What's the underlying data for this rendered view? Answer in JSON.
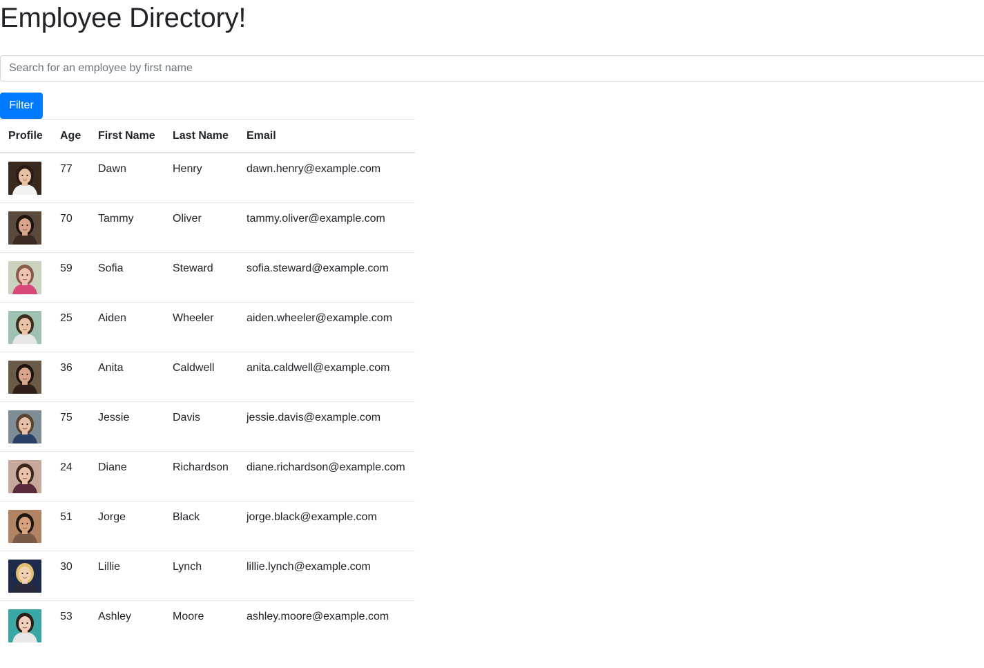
{
  "page": {
    "title": "Employee Directory!"
  },
  "search": {
    "placeholder": "Search for an employee by first name",
    "value": ""
  },
  "filter_button": {
    "label": "Filter",
    "color": "#007bff"
  },
  "table": {
    "headers": {
      "profile": "Profile",
      "age": "Age",
      "first_name": "First Name",
      "last_name": "Last Name",
      "email": "Email"
    },
    "rows": [
      {
        "age": "77",
        "first_name": "Dawn",
        "last_name": "Henry",
        "email": "dawn.henry@example.com",
        "avatar": {
          "bg": "#3a2a1e",
          "skin": "#e8c2a4",
          "hair": "#2b1a12",
          "shirt": "#f2f2f2"
        }
      },
      {
        "age": "70",
        "first_name": "Tammy",
        "last_name": "Oliver",
        "email": "tammy.oliver@example.com",
        "avatar": {
          "bg": "#5a4a3c",
          "skin": "#d8a58a",
          "hair": "#1e120c",
          "shirt": "#3a2a22"
        }
      },
      {
        "age": "59",
        "first_name": "Sofia",
        "last_name": "Steward",
        "email": "sofia.steward@example.com",
        "avatar": {
          "bg": "#c9d3c0",
          "skin": "#f0c4b4",
          "hair": "#8a5a4a",
          "shirt": "#d8467a"
        }
      },
      {
        "age": "25",
        "first_name": "Aiden",
        "last_name": "Wheeler",
        "email": "aiden.wheeler@example.com",
        "avatar": {
          "bg": "#9fc2b0",
          "skin": "#e8c4a8",
          "hair": "#3a2a1e",
          "shirt": "#e6e6e6"
        }
      },
      {
        "age": "36",
        "first_name": "Anita",
        "last_name": "Caldwell",
        "email": "anita.caldwell@example.com",
        "avatar": {
          "bg": "#6a5a48",
          "skin": "#d8a58a",
          "hair": "#1e120c",
          "shirt": "#2e2018"
        }
      },
      {
        "age": "75",
        "first_name": "Jessie",
        "last_name": "Davis",
        "email": "jessie.davis@example.com",
        "avatar": {
          "bg": "#7e8c96",
          "skin": "#e6c2aa",
          "hair": "#5a4230",
          "shirt": "#2a3e66"
        }
      },
      {
        "age": "24",
        "first_name": "Diane",
        "last_name": "Richardson",
        "email": "diane.richardson@example.com",
        "avatar": {
          "bg": "#c6a89a",
          "skin": "#ecc4ae",
          "hair": "#3a2418",
          "shirt": "#5a2a3a"
        }
      },
      {
        "age": "51",
        "first_name": "Jorge",
        "last_name": "Black",
        "email": "jorge.black@example.com",
        "avatar": {
          "bg": "#b08462",
          "skin": "#d9a27e",
          "hair": "#1e140e",
          "shirt": "#7a5a44"
        }
      },
      {
        "age": "30",
        "first_name": "Lillie",
        "last_name": "Lynch",
        "email": "lillie.lynch@example.com",
        "avatar": {
          "bg": "#1e2a4a",
          "skin": "#f2d0b4",
          "hair": "#e0c070",
          "shirt": "#262a3a"
        }
      },
      {
        "age": "53",
        "first_name": "Ashley",
        "last_name": "Moore",
        "email": "ashley.moore@example.com",
        "avatar": {
          "bg": "#3aa6a6",
          "skin": "#f0d0bc",
          "hair": "#2a1e16",
          "shirt": "#e8e8e8"
        }
      }
    ]
  }
}
